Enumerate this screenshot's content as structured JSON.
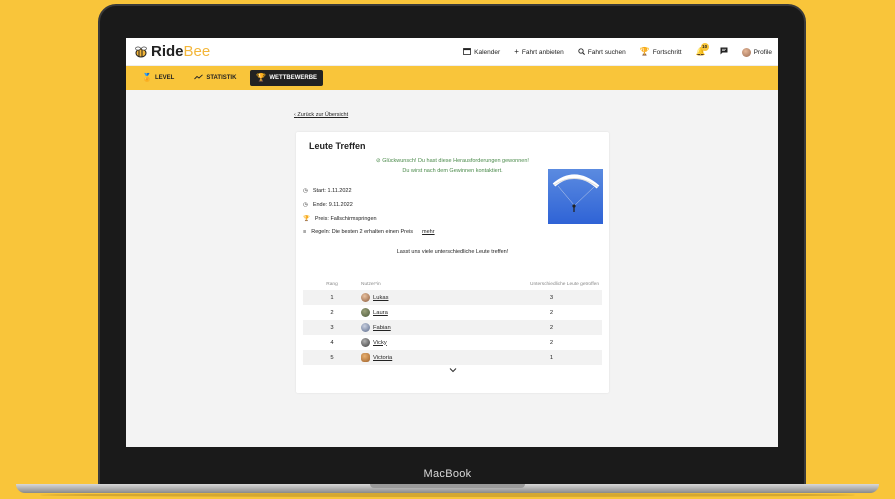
{
  "brand": {
    "ride": "Ride",
    "bee": "Bee"
  },
  "nav": {
    "calendar": "Kalender",
    "offer_ride": "Fahrt anbieten",
    "search_ride": "Fahrt suchen",
    "progress": "Fortschritt",
    "notifications_count": "10",
    "profile": "Profile"
  },
  "subnav": {
    "level": "LEVEL",
    "statistics": "STATISTIK",
    "competitions": "WETTBEWERBE"
  },
  "back_link": "Zurück zur Übersicht",
  "challenge": {
    "title": "Leute Treffen",
    "congrats_line1": "Glückwunsch! Du hast diese Herausforderungen gewonnen!",
    "congrats_line2": "Du wirst nach dem Gewinnen kontaktiert.",
    "start": "Start: 1.11.2022",
    "end": "Ende: 9.11.2022",
    "prize": "Preis: Fallschirmspringen",
    "rules": "Regeln: Die besten 2 erhalten einen Preis",
    "more": "mehr",
    "tagline": "Lasst uns viele unterschiedliche Leute treffen!"
  },
  "leaderboard": {
    "headers": {
      "rank": "Rang",
      "user": "Nutzer*in",
      "met": "Unterschiedliche Leute getroffen"
    },
    "rows": [
      {
        "rank": "1",
        "name": "Lukas",
        "met": "3"
      },
      {
        "rank": "2",
        "name": "Laura",
        "met": "2"
      },
      {
        "rank": "3",
        "name": "Fabian",
        "met": "2"
      },
      {
        "rank": "4",
        "name": "Vicky",
        "met": "2"
      },
      {
        "rank": "5",
        "name": "Victoria",
        "met": "1"
      }
    ]
  },
  "device_label": "MacBook",
  "colors": {
    "accent": "#f9c53a",
    "success": "#4a8a4a"
  }
}
